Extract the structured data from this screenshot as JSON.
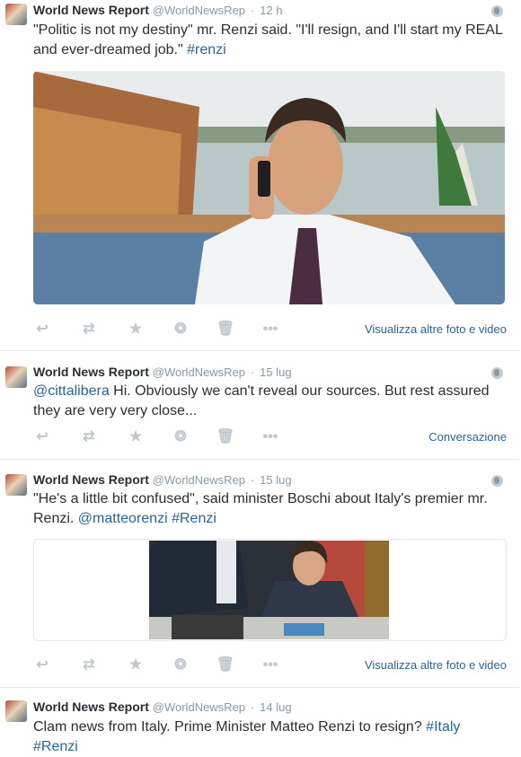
{
  "tweets": [
    {
      "name": "World News Report",
      "handle": "@WorldNewsRep",
      "time": "12 h",
      "text_before": "\"Politic is not my destiny\" mr. Renzi said. \"I'll resign, and I'll start my REAL and ever-dreamed job.\" ",
      "hashtag": "#renzi",
      "action_link": "Visualizza altre foto e video"
    },
    {
      "name": "World News Report",
      "handle": "@WorldNewsRep",
      "time": "15 lug",
      "mention": "@cittalibera",
      "text_after": " Hi. Obviously we can't reveal our sources. But rest assured they are very very close...",
      "action_link": "Conversazione"
    },
    {
      "name": "World News Report",
      "handle": "@WorldNewsRep",
      "time": "15 lug",
      "text_before": "\"He's a little bit confused\", said minister Boschi about Italy's premier mr. Renzi. ",
      "mention": "@matteorenzi",
      "hashtag": "#Renzi",
      "action_link": "Visualizza altre foto e video"
    },
    {
      "name": "World News Report",
      "handle": "@WorldNewsRep",
      "time": "14 lug",
      "text_before": "Clam news from Italy. Prime Minister Matteo Renzi to resign? ",
      "hashtag": "#Italy",
      "hashtag2": "#Renzi"
    }
  ],
  "icons": [
    "reply-icon",
    "retweet-icon",
    "favorite-icon",
    "vine-icon",
    "delete-icon",
    "more-icon",
    "globe-icon"
  ],
  "colors": {
    "link": "#2a6496",
    "muted": "#8899a6",
    "icon": "#c0c8ce"
  }
}
